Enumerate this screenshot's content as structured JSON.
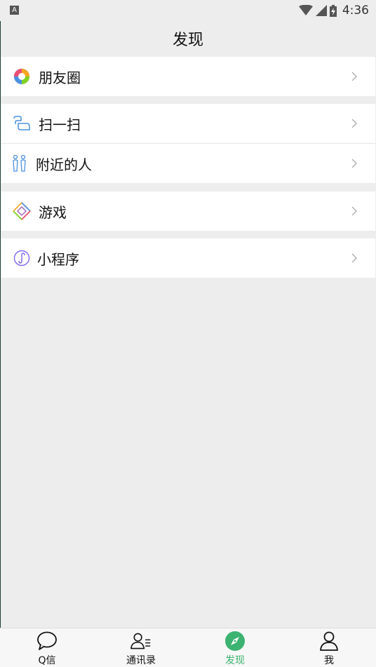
{
  "status_bar": {
    "time": "4:36",
    "indicator": "A"
  },
  "header": {
    "title": "发现"
  },
  "groups": [
    {
      "items": [
        {
          "label": "朋友圈",
          "icon": "moments-icon"
        }
      ]
    },
    {
      "items": [
        {
          "label": "扫一扫",
          "icon": "scan-icon"
        },
        {
          "label": "附近的人",
          "icon": "nearby-people-icon"
        }
      ]
    },
    {
      "items": [
        {
          "label": "游戏",
          "icon": "game-icon"
        }
      ]
    },
    {
      "items": [
        {
          "label": "小程序",
          "icon": "mini-program-icon"
        }
      ]
    }
  ],
  "tabbar": {
    "tabs": [
      {
        "label": "Q信",
        "icon": "chat-bubble-icon",
        "active": false
      },
      {
        "label": "通讯录",
        "icon": "contacts-icon",
        "active": false
      },
      {
        "label": "发现",
        "icon": "compass-icon",
        "active": true
      },
      {
        "label": "我",
        "icon": "person-icon",
        "active": false
      }
    ]
  },
  "colors": {
    "active": "#3cb371",
    "background": "#ededed",
    "chevron": "#b2b2b2"
  }
}
